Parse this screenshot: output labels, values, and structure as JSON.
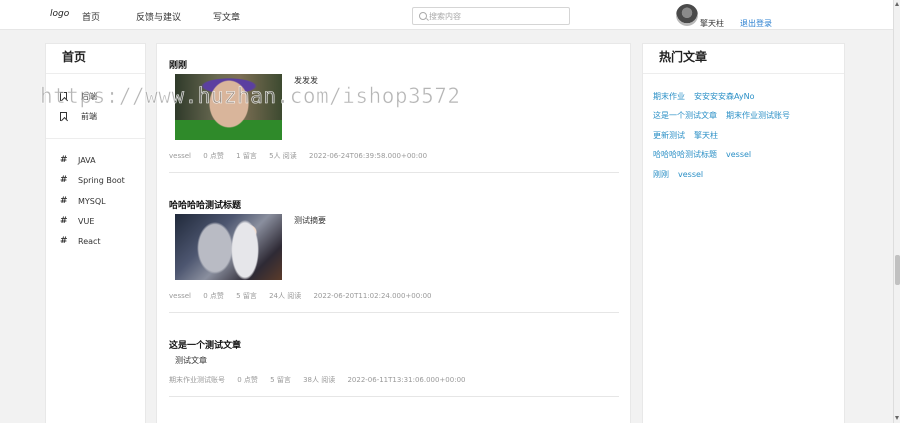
{
  "header": {
    "logo": "logo",
    "nav": [
      "首页",
      "反馈与建议",
      "写文章"
    ],
    "search_placeholder": "搜索内容",
    "username": "擎天柱",
    "logout": "退出登录"
  },
  "left": {
    "title": "首页",
    "links": [
      "后端",
      "前端"
    ],
    "tags": [
      "JAVA",
      "Spring Boot",
      "MYSQL",
      "VUE",
      "React"
    ]
  },
  "articles": [
    {
      "title": "刚刚",
      "summary": "发发发",
      "author": "vessel",
      "likes": "0 点赞",
      "comments": "1 留言",
      "reads": "5人 阅读",
      "time": "2022-06-24T06:39:58.000+00:00"
    },
    {
      "title": "哈哈哈哈测试标题",
      "summary": "测试摘要",
      "author": "vessel",
      "likes": "0 点赞",
      "comments": "5 留言",
      "reads": "24人 阅读",
      "time": "2022-06-20T11:02:24.000+00:00"
    },
    {
      "title": "这是一个测试文章",
      "summary": "测试文章",
      "author": "期末作业测试账号",
      "likes": "0 点赞",
      "comments": "5 留言",
      "reads": "38人 阅读",
      "time": "2022-06-11T13:31:06.000+00:00"
    }
  ],
  "right": {
    "title": "热门文章",
    "hot": [
      [
        "期末作业",
        "安安安安森AyNo"
      ],
      [
        "这是一个测试文章",
        "期末作业测试账号"
      ],
      [
        "更新测试",
        "擎天柱"
      ],
      [
        "哈哈哈哈测试标题",
        "vessel"
      ],
      [
        "刚刚",
        "vessel"
      ]
    ]
  },
  "watermark": "https://www.huzhan.com/ishop3572"
}
